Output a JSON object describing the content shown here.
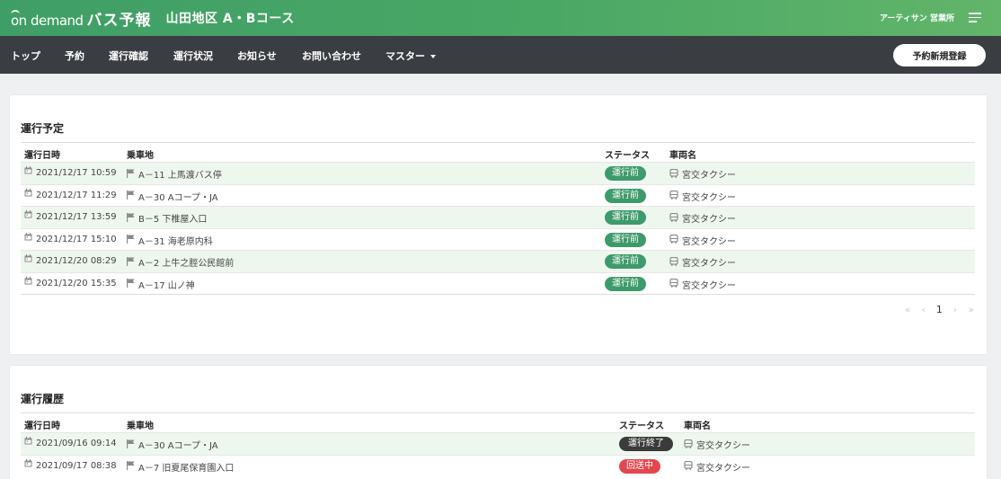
{
  "app": {
    "logo_prefix": "on demand",
    "logo_main": "バス予報",
    "course_title": "山田地区 A・Bコース",
    "user_name": "アーティサン 営業所"
  },
  "nav": {
    "items": [
      "トップ",
      "予約",
      "運行確認",
      "運行状況",
      "お知らせ",
      "お問い合わせ",
      "マスター"
    ],
    "new_reservation_label": "予約新規登録"
  },
  "schedule": {
    "title": "運行予定",
    "columns": [
      "運行日時",
      "乗車地",
      "ステータス",
      "車両名"
    ],
    "rows": [
      {
        "datetime": "2021/12/17 10:59",
        "stop": "A－11 上馬渡バス停",
        "status": "運行前",
        "vehicle": "宮交タクシー"
      },
      {
        "datetime": "2021/12/17 11:29",
        "stop": "A－30 Aコープ・JA",
        "status": "運行前",
        "vehicle": "宮交タクシー"
      },
      {
        "datetime": "2021/12/17 13:59",
        "stop": "B－5 下椎屋入口",
        "status": "運行前",
        "vehicle": "宮交タクシー"
      },
      {
        "datetime": "2021/12/17 15:10",
        "stop": "A－31 海老原内科",
        "status": "運行前",
        "vehicle": "宮交タクシー"
      },
      {
        "datetime": "2021/12/20 08:29",
        "stop": "A－2 上牛之脛公民館前",
        "status": "運行前",
        "vehicle": "宮交タクシー"
      },
      {
        "datetime": "2021/12/20 15:35",
        "stop": "A－17 山ノ神",
        "status": "運行前",
        "vehicle": "宮交タクシー"
      }
    ],
    "pager": {
      "first": "«",
      "prev": "‹",
      "current": "1",
      "next": "›",
      "last": "»"
    }
  },
  "history": {
    "title": "運行履歴",
    "columns": [
      "運行日時",
      "乗車地",
      "ステータス",
      "車両名"
    ],
    "rows": [
      {
        "datetime": "2021/09/16 09:14",
        "stop": "A－30 Aコープ・JA",
        "status": "運行終了",
        "vehicle": "宮交タクシー"
      },
      {
        "datetime": "2021/09/17 08:38",
        "stop": "A－7 旧夏尾保育園入口",
        "status": "回送中",
        "vehicle": "宮交タクシー"
      }
    ]
  },
  "colors": {
    "brand_green": "#4aa865",
    "nav_dark": "#3a3d41",
    "status_before": "#3d9a6a",
    "status_done": "#3b3b3b",
    "status_returning": "#e2474f",
    "row_stripe": "#eef7ee"
  },
  "icons": {
    "date": "calendar-icon",
    "stop": "flag-icon",
    "vehicle": "bus-icon",
    "menu": "hamburger-menu-icon",
    "dropdown": "caret-down-icon"
  }
}
